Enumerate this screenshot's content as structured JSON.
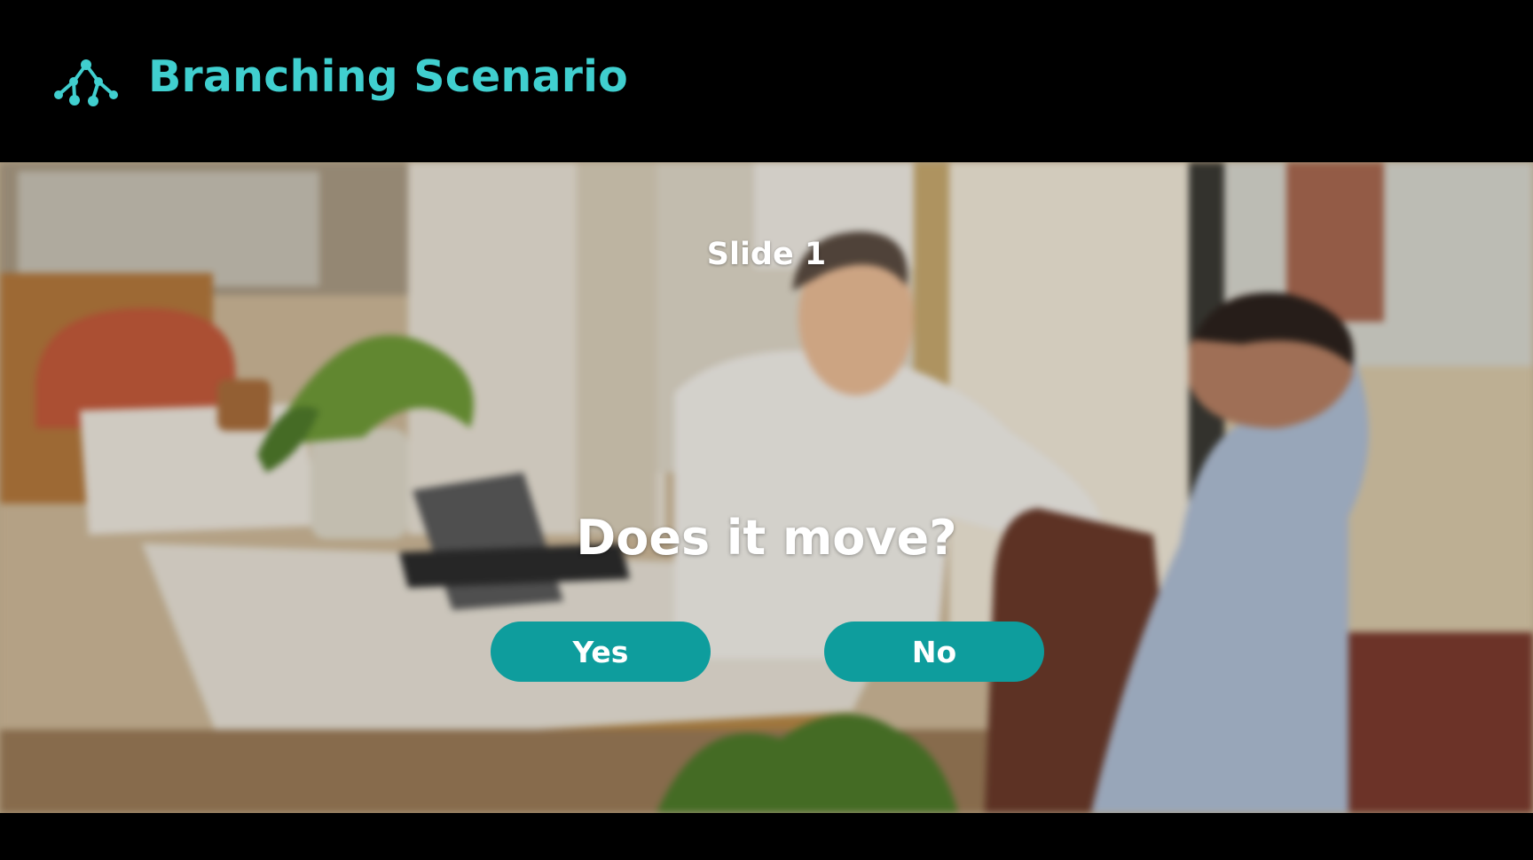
{
  "header": {
    "title": "Branching Scenario",
    "icon": "branching-icon",
    "accent_color": "#40cfcf"
  },
  "slide": {
    "label": "Slide 1",
    "question": "Does it move?",
    "choices": [
      {
        "label": "Yes"
      },
      {
        "label": "No"
      }
    ],
    "button_color": "#0e9d9d",
    "background": "office-meeting-photo"
  }
}
